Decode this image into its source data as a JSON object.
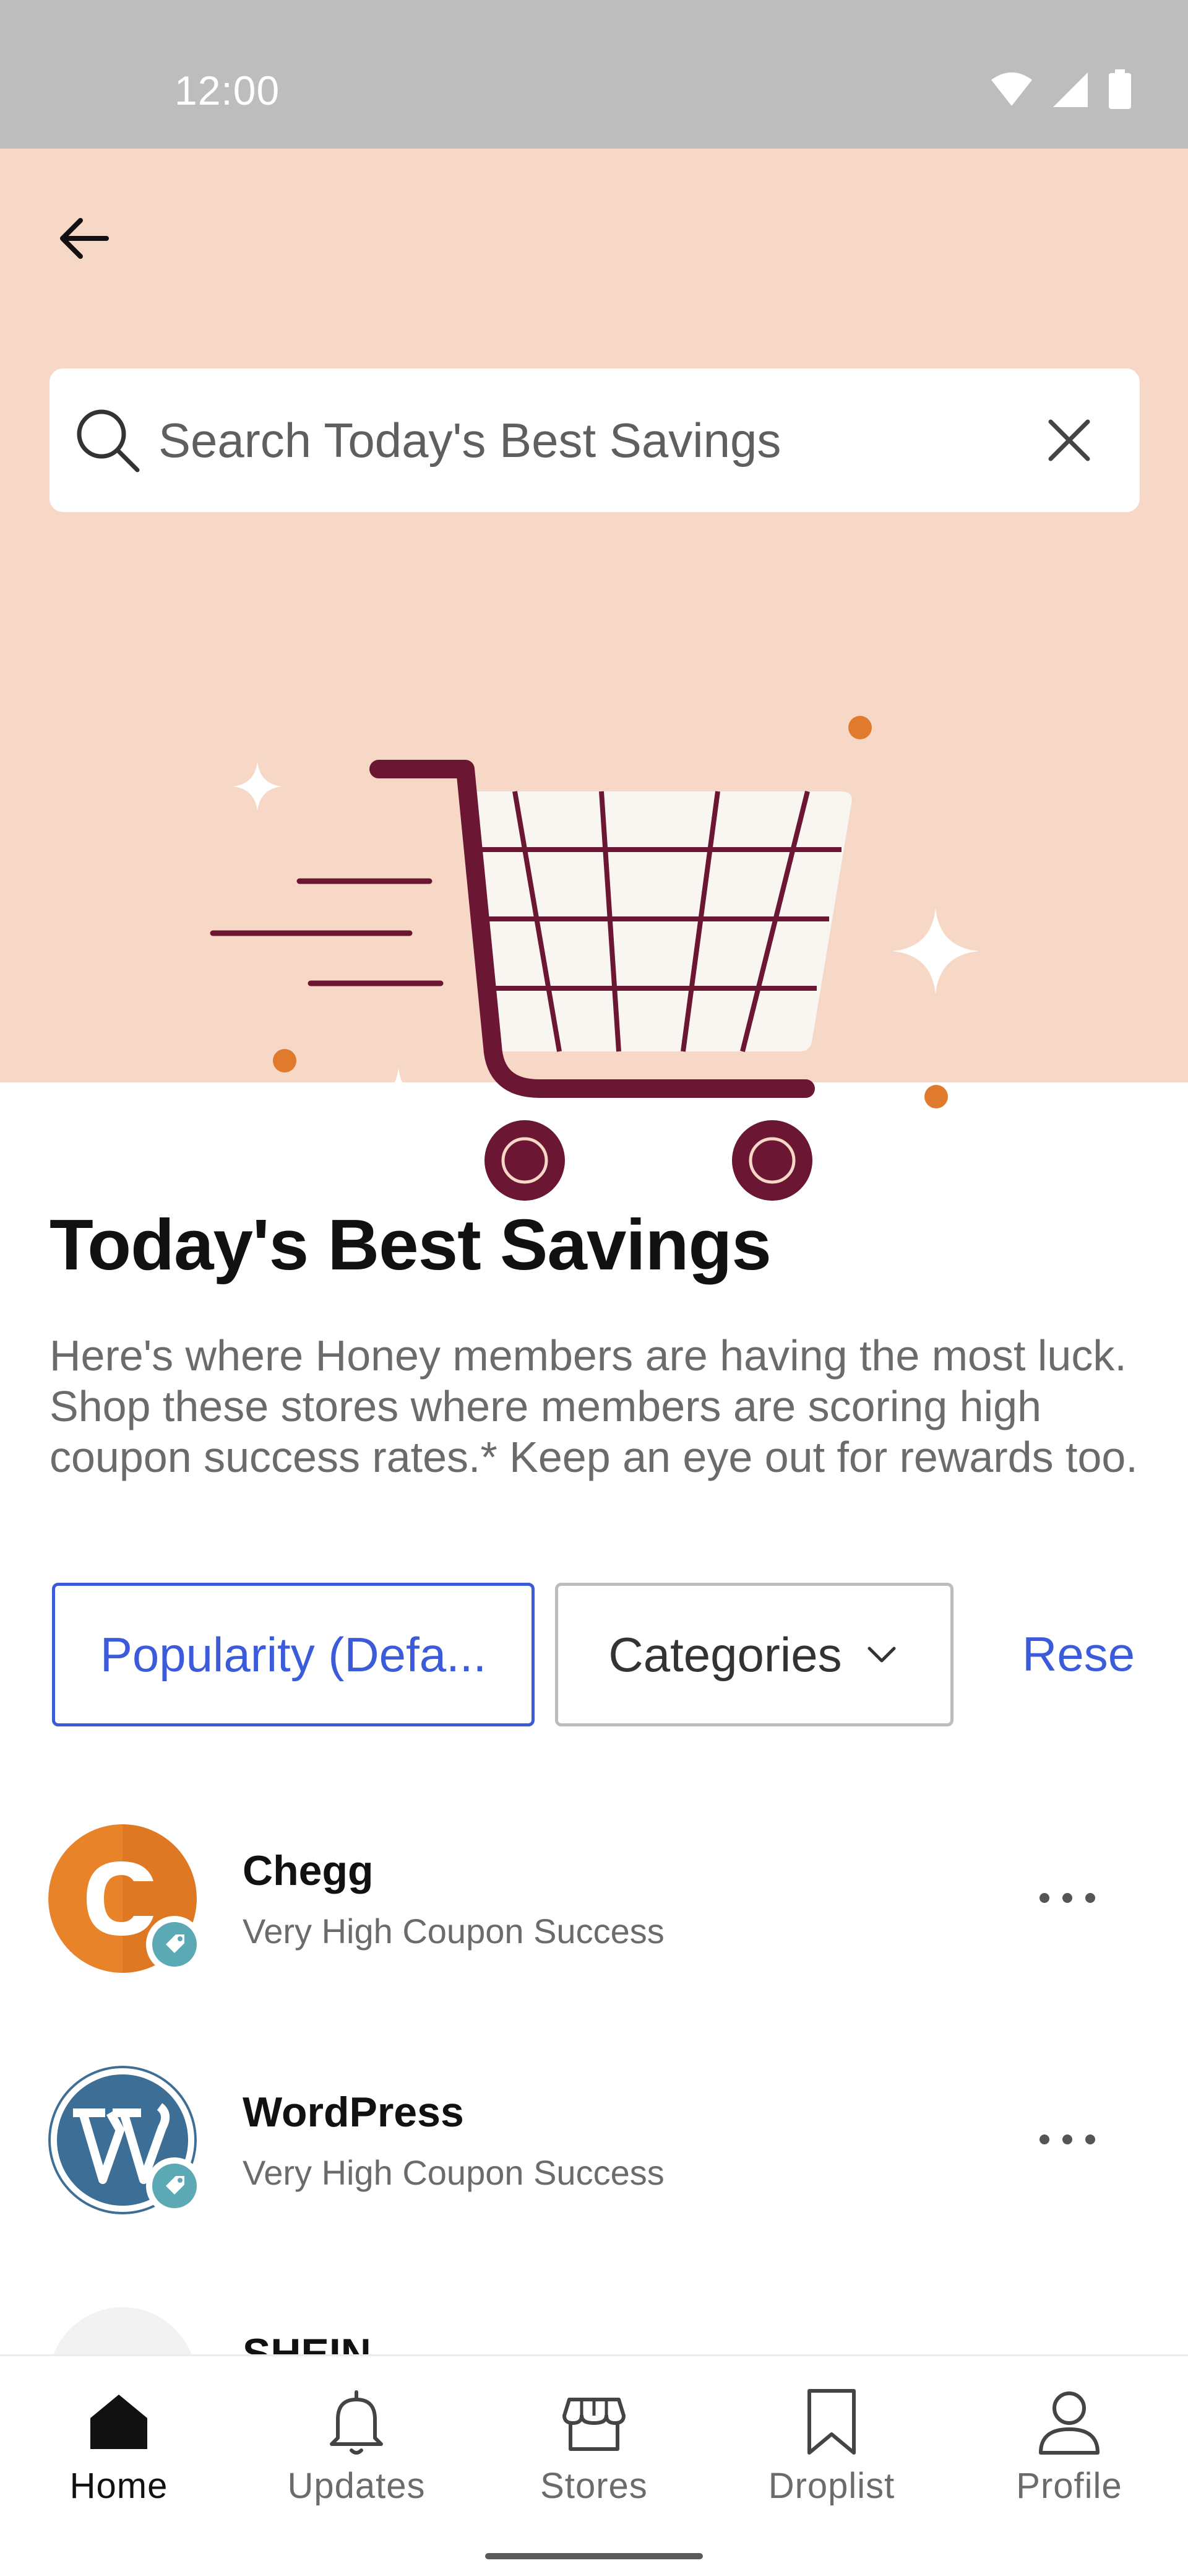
{
  "status_bar": {
    "time": "12:00"
  },
  "search": {
    "placeholder": "Search Today's Best Savings"
  },
  "main": {
    "title": "Today's Best Savings",
    "description": "Here's where Honey members are having the most luck. Shop these stores where members are scoring high coupon success rates.* Keep an eye out for rewards too."
  },
  "filters": {
    "sort_label": "Popularity (Defa...",
    "categories_label": "Categories",
    "reset_label": "Rese"
  },
  "stores": [
    {
      "name": "Chegg",
      "subtitle": "Very High Coupon Success",
      "logo_color": "#e8832a",
      "icon": "chegg-logo"
    },
    {
      "name": "WordPress",
      "subtitle": "Very High Coupon Success",
      "logo_color": "#3d6e96",
      "icon": "wordpress-logo"
    },
    {
      "name": "SHEIN",
      "subtitle": "",
      "logo_color": "#f2f2f2",
      "icon": "shein-logo"
    }
  ],
  "bottom_nav": {
    "items": [
      {
        "label": "Home",
        "icon": "home-icon",
        "active": true
      },
      {
        "label": "Updates",
        "icon": "bell-icon",
        "active": false
      },
      {
        "label": "Stores",
        "icon": "store-icon",
        "active": false
      },
      {
        "label": "Droplist",
        "icon": "bookmark-icon",
        "active": false
      },
      {
        "label": "Profile",
        "icon": "person-icon",
        "active": false
      }
    ]
  },
  "colors": {
    "hero_background": "#f7d7c6",
    "accent": "#3b5bdb",
    "cart": "#6b1633",
    "dots": "#e07b2e",
    "badge": "#5aa9b5"
  }
}
